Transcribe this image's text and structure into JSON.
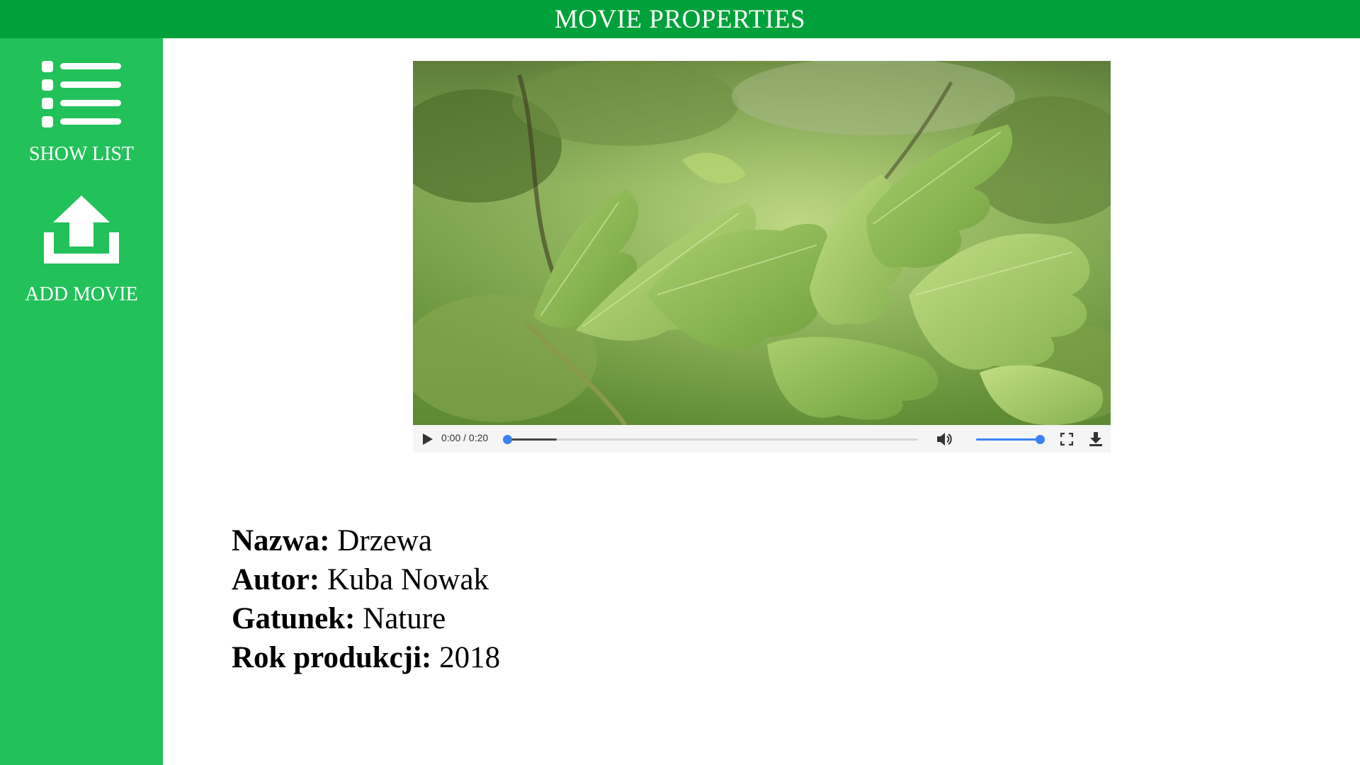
{
  "header": {
    "title": "MOVIE PROPERTIES"
  },
  "sidebar": {
    "items": [
      {
        "label": "SHOW LIST",
        "icon": "list-icon"
      },
      {
        "label": "ADD MOVIE",
        "icon": "upload-icon"
      }
    ]
  },
  "player": {
    "time_display": "0:00 / 0:20",
    "current_time": "0:00",
    "duration": "0:20",
    "progress": 0.0,
    "buffered": 0.12,
    "volume": 1.0,
    "icons": [
      "play-icon",
      "volume-icon",
      "fullscreen-icon",
      "download-icon"
    ]
  },
  "movie": {
    "fields": [
      {
        "key": "Nazwa:",
        "value": "Drzewa"
      },
      {
        "key": "Autor:",
        "value": "Kuba Nowak"
      },
      {
        "key": "Gatunek:",
        "value": "Nature"
      },
      {
        "key": "Rok produkcji:",
        "value": "2018"
      }
    ]
  },
  "colors": {
    "header": "#00a13a",
    "sidebar": "#22c15a",
    "accent": "#3b82f6"
  }
}
